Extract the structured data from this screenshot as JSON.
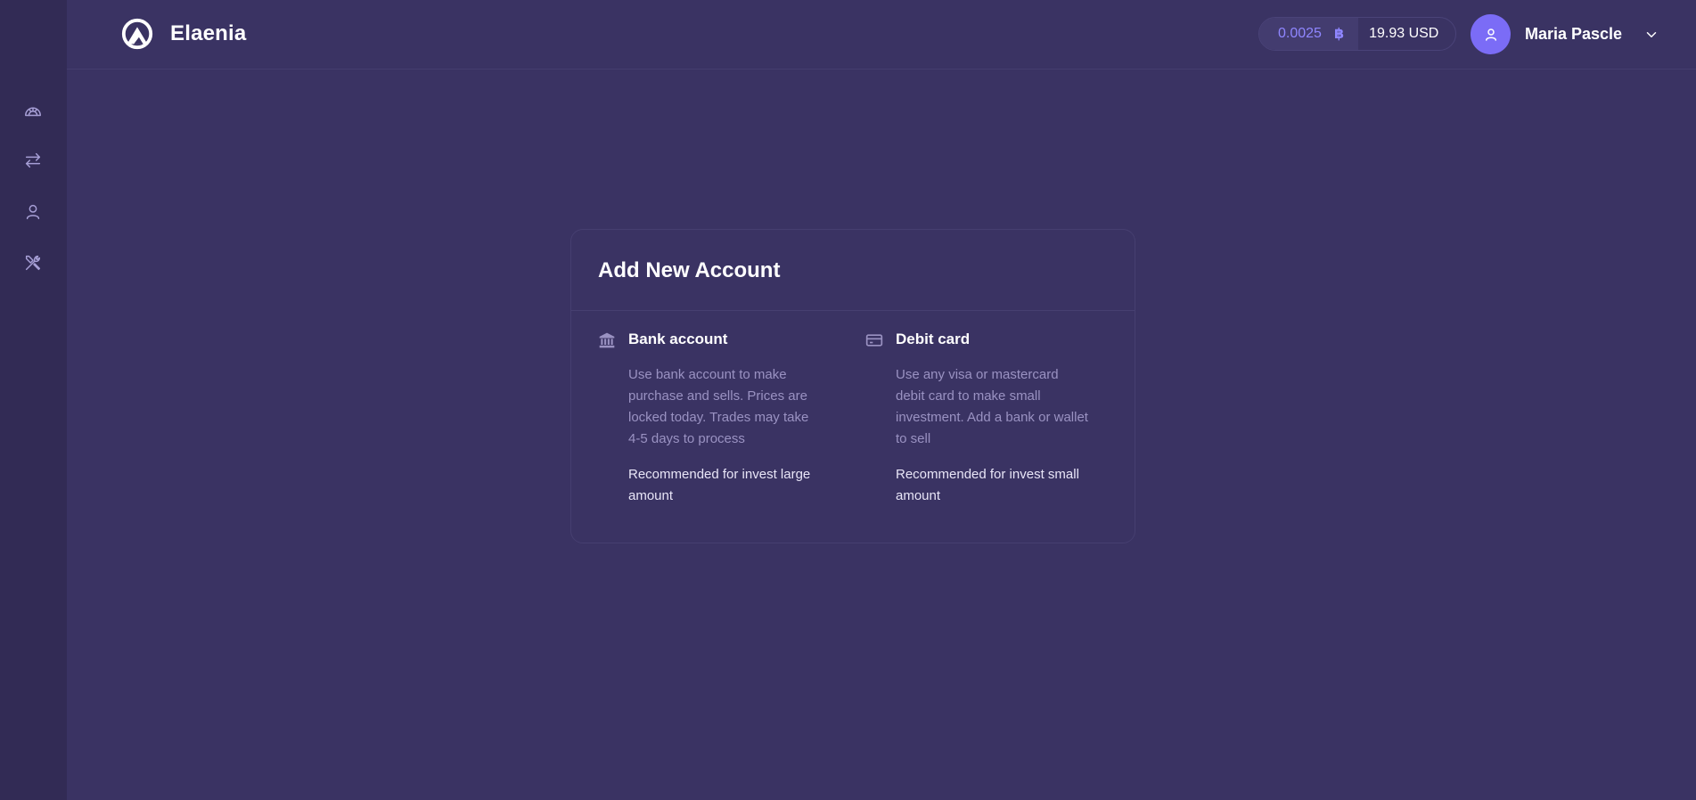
{
  "app": {
    "brand_name": "Elaenia"
  },
  "sidebar": {
    "items": [
      {
        "name": "dashboard",
        "icon": "gauge-icon"
      },
      {
        "name": "exchange",
        "icon": "swap-arrows-icon"
      },
      {
        "name": "profile",
        "icon": "user-icon"
      },
      {
        "name": "settings",
        "icon": "tools-icon"
      }
    ]
  },
  "header": {
    "balance_crypto": "0.0025",
    "crypto_symbol": "฿",
    "balance_fiat": "19.93 USD",
    "user_name": "Maria Pascle"
  },
  "card": {
    "title": "Add New Account",
    "options": [
      {
        "title": "Bank account",
        "icon": "bank-icon",
        "description": "Use bank account to make purchase and sells. Prices are locked today. Trades may take 4-5 days to process",
        "recommendation": "Recommended for invest large amount"
      },
      {
        "title": "Debit card",
        "icon": "credit-card-icon",
        "description": "Use any visa or mastercard debit card to make small investment. Add a bank or wallet to sell",
        "recommendation": "Recommended for invest small amount"
      }
    ]
  },
  "colors": {
    "background": "#3a3363",
    "sidebar": "#322b55",
    "accent": "#7b6cf6",
    "muted_text": "#9a92c2"
  }
}
